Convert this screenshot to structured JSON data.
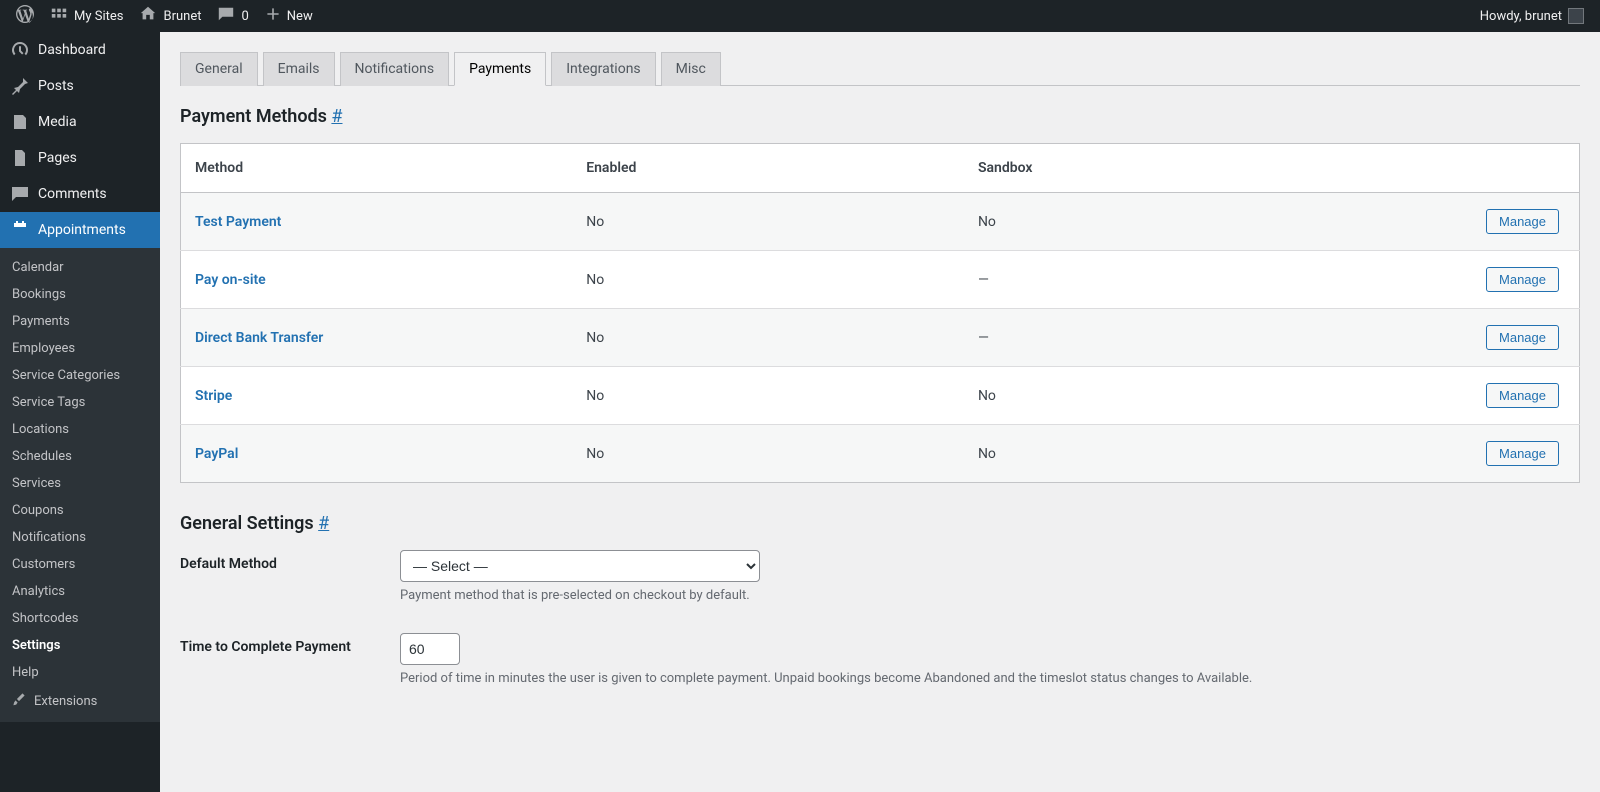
{
  "adminBar": {
    "mySites": "My Sites",
    "siteName": "Brunet",
    "commentsCount": "0",
    "new": "New",
    "howdy": "Howdy, brunet"
  },
  "sidebar": {
    "dashboard": "Dashboard",
    "posts": "Posts",
    "media": "Media",
    "pages": "Pages",
    "comments": "Comments",
    "appointments": "Appointments",
    "submenu": {
      "calendar": "Calendar",
      "bookings": "Bookings",
      "payments": "Payments",
      "employees": "Employees",
      "serviceCategories": "Service Categories",
      "serviceTags": "Service Tags",
      "locations": "Locations",
      "schedules": "Schedules",
      "services": "Services",
      "coupons": "Coupons",
      "notifications": "Notifications",
      "customers": "Customers",
      "analytics": "Analytics",
      "shortcodes": "Shortcodes",
      "settings": "Settings",
      "help": "Help",
      "extensions": "Extensions"
    }
  },
  "tabs": {
    "general": "General",
    "emails": "Emails",
    "notifications": "Notifications",
    "payments": "Payments",
    "integrations": "Integrations",
    "misc": "Misc"
  },
  "sections": {
    "paymentMethods": "Payment Methods ",
    "generalSettings": "General Settings ",
    "anchor": "#"
  },
  "table": {
    "headers": {
      "method": "Method",
      "enabled": "Enabled",
      "sandbox": "Sandbox"
    },
    "rows": [
      {
        "method": "Test Payment",
        "enabled": "No",
        "sandbox": "No",
        "manage": "Manage"
      },
      {
        "method": "Pay on-site",
        "enabled": "No",
        "sandbox": "—",
        "manage": "Manage"
      },
      {
        "method": "Direct Bank Transfer",
        "enabled": "No",
        "sandbox": "—",
        "manage": "Manage"
      },
      {
        "method": "Stripe",
        "enabled": "No",
        "sandbox": "No",
        "manage": "Manage"
      },
      {
        "method": "PayPal",
        "enabled": "No",
        "sandbox": "No",
        "manage": "Manage"
      }
    ]
  },
  "form": {
    "defaultMethod": {
      "label": "Default Method",
      "selected": "— Select —",
      "desc": "Payment method that is pre-selected on checkout by default."
    },
    "timeToComplete": {
      "label": "Time to Complete Payment",
      "value": "60",
      "desc": "Period of time in minutes the user is given to complete payment. Unpaid bookings become Abandoned and the timeslot status changes to Available."
    }
  }
}
